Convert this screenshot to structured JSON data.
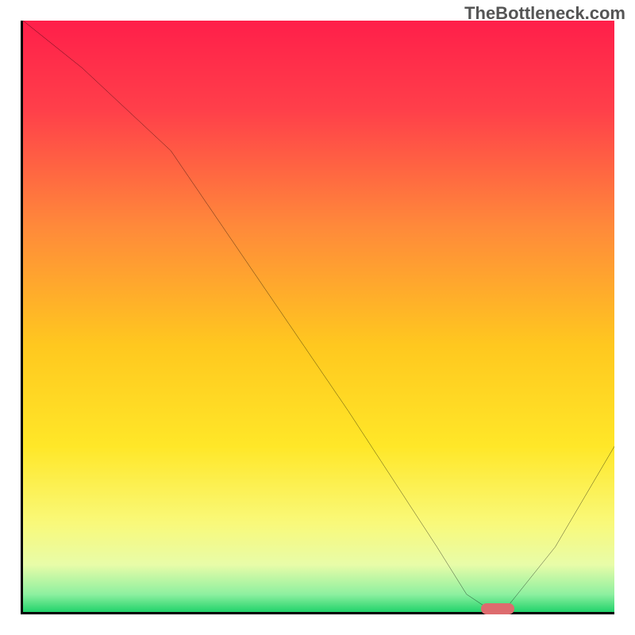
{
  "watermark": "TheBottleneck.com",
  "chart_data": {
    "type": "line",
    "title": "",
    "xlabel": "",
    "ylabel": "",
    "xlim": [
      0,
      100
    ],
    "ylim": [
      0,
      100
    ],
    "x": [
      0,
      10,
      25,
      40,
      55,
      70,
      75,
      78,
      82,
      90,
      100
    ],
    "y": [
      100,
      92,
      78,
      56,
      34,
      11,
      3,
      1,
      1,
      11,
      28
    ],
    "marker": {
      "x": 80,
      "y": 1
    },
    "gradient_stops": [
      {
        "pos": 0.0,
        "color": "#ff1f4a"
      },
      {
        "pos": 0.15,
        "color": "#ff3f4a"
      },
      {
        "pos": 0.35,
        "color": "#ff8a3a"
      },
      {
        "pos": 0.55,
        "color": "#ffc81f"
      },
      {
        "pos": 0.72,
        "color": "#ffe728"
      },
      {
        "pos": 0.85,
        "color": "#f9f97a"
      },
      {
        "pos": 0.92,
        "color": "#e8fca8"
      },
      {
        "pos": 0.97,
        "color": "#8ef0a0"
      },
      {
        "pos": 1.0,
        "color": "#22d36b"
      }
    ]
  }
}
